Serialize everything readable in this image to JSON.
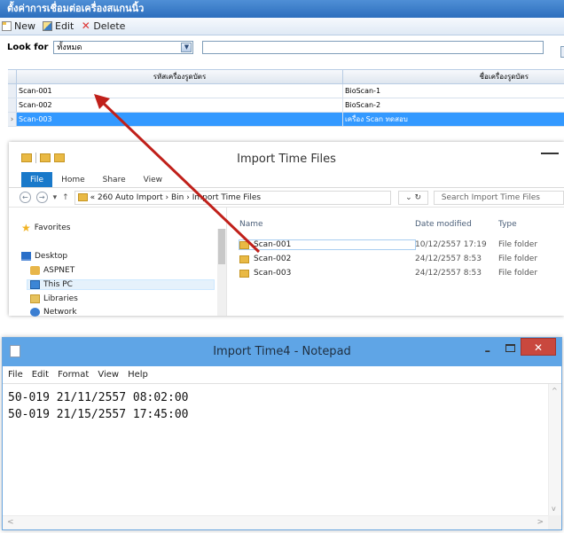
{
  "app": {
    "title": "ตั้งค่าการเชื่อมต่อเครื่องสแกนนิ้ว",
    "toolbar": {
      "new_label": "New",
      "edit_label": "Edit",
      "delete_label": "Delete"
    },
    "look_for_label": "Look for",
    "look_for_value": "ทั้งหมด",
    "grid": {
      "columns": [
        "รหัสเครื่องรูดบัตร",
        "ชื่อเครื่องรูดบัตร"
      ],
      "rows": [
        {
          "id": "Scan-001",
          "name": "BioScan-1"
        },
        {
          "id": "Scan-002",
          "name": "BioScan-2"
        },
        {
          "id": "Scan-003",
          "name": "เครื่อง Scan ทดสอบ"
        }
      ],
      "selected_row": 2
    }
  },
  "explorer": {
    "title": "Import Time Files",
    "ribbon_tabs": [
      "File",
      "Home",
      "Share",
      "View"
    ],
    "address_path": "« 260 Auto Import › Bin › Import Time Files",
    "search_placeholder": "Search Import Time Files",
    "nav": {
      "favorites": "Favorites",
      "desktop": "Desktop",
      "aspnet": "ASPNET",
      "this_pc": "This PC",
      "libraries": "Libraries",
      "network": "Network"
    },
    "columns": {
      "name": "Name",
      "date": "Date modified",
      "type": "Type"
    },
    "files": [
      {
        "name": "Scan-001",
        "date": "10/12/2557 17:19",
        "type": "File folder"
      },
      {
        "name": "Scan-002",
        "date": "24/12/2557 8:53",
        "type": "File folder"
      },
      {
        "name": "Scan-003",
        "date": "24/12/2557 8:53",
        "type": "File folder"
      }
    ]
  },
  "notepad": {
    "title": "Import Time4 - Notepad",
    "menu": [
      "File",
      "Edit",
      "Format",
      "View",
      "Help"
    ],
    "lines": [
      "50-019 21/11/2557 08:02:00",
      "50-019 21/15/2557 17:45:00"
    ]
  },
  "colors": {
    "selected_row": "#3399ff",
    "arrow": "#c0201a",
    "title_bar": "#5fa5e6"
  }
}
